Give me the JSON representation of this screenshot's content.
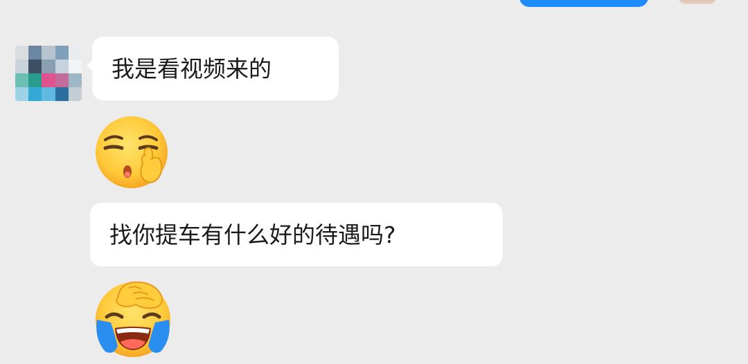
{
  "messages": [
    {
      "type": "text",
      "sender": "contact",
      "text": "我是看视频来的"
    },
    {
      "type": "emoji",
      "sender": "contact",
      "emoji": "thinking-pout-emoji"
    },
    {
      "type": "text",
      "sender": "contact",
      "text": "找你提车有什么好的待遇吗?"
    },
    {
      "type": "emoji",
      "sender": "contact",
      "emoji": "crying-laughing-facepalm-emoji"
    }
  ],
  "colors": {
    "background": "#ececec",
    "bubble_incoming": "#ffffff",
    "bubble_outgoing": "#1e8bff",
    "text": "#1b1b1b"
  }
}
